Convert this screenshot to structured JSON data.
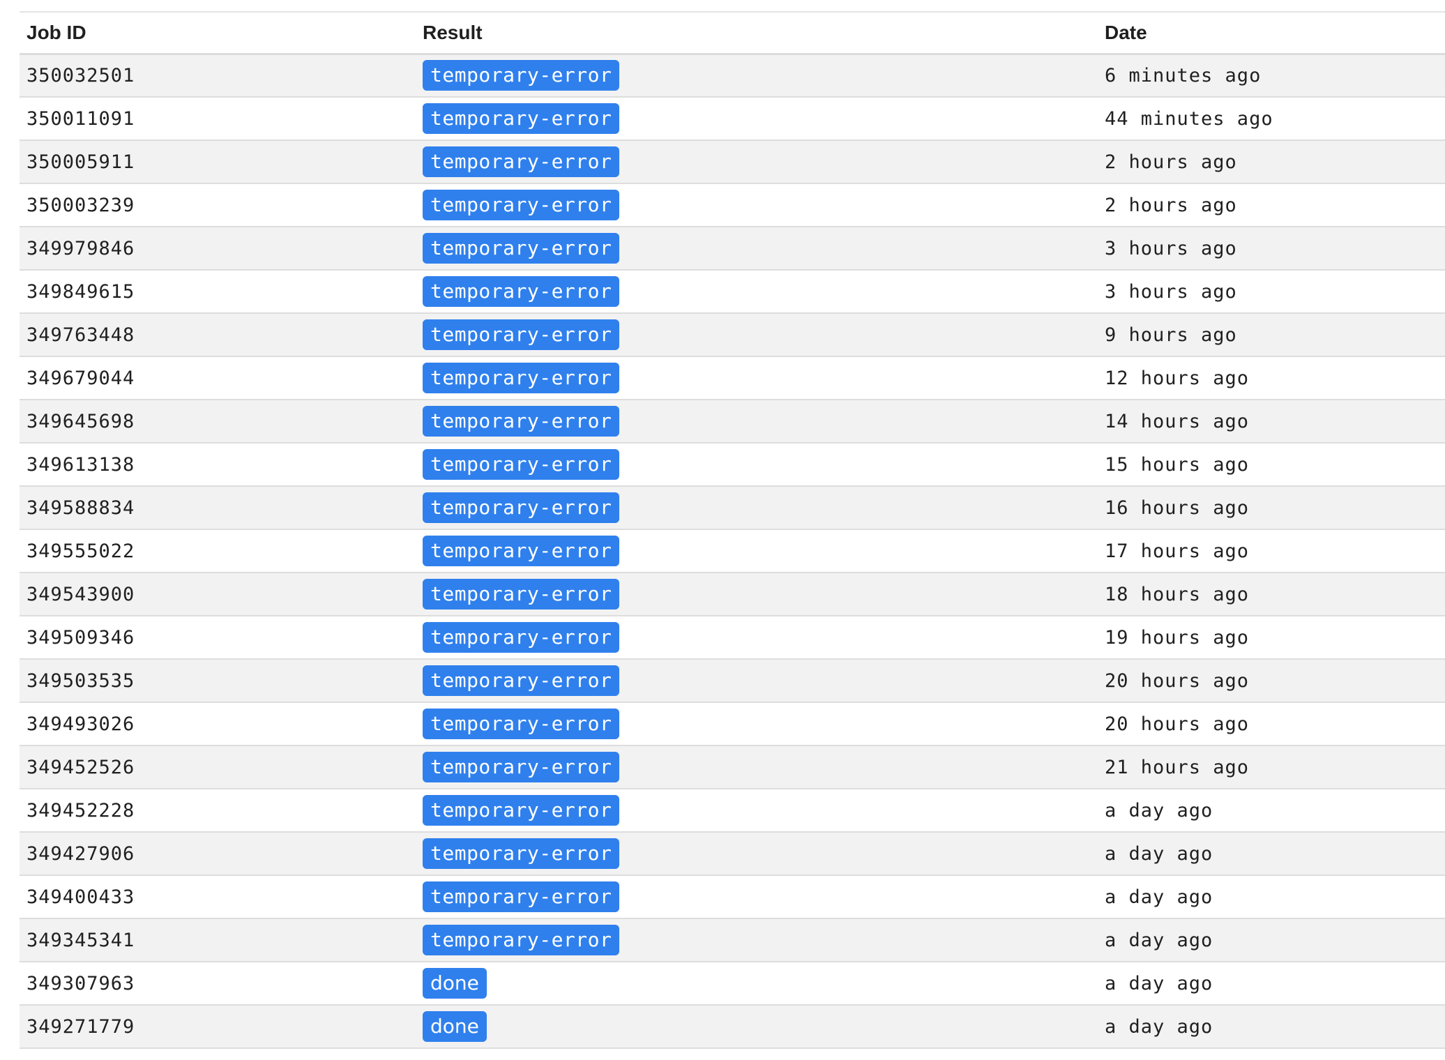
{
  "table": {
    "headers": {
      "job_id": "Job ID",
      "result": "Result",
      "date": "Date"
    },
    "rows": [
      {
        "job_id": "350032501",
        "result": "temporary-error",
        "date": "6 minutes ago"
      },
      {
        "job_id": "350011091",
        "result": "temporary-error",
        "date": "44 minutes ago"
      },
      {
        "job_id": "350005911",
        "result": "temporary-error",
        "date": "2 hours ago"
      },
      {
        "job_id": "350003239",
        "result": "temporary-error",
        "date": "2 hours ago"
      },
      {
        "job_id": "349979846",
        "result": "temporary-error",
        "date": "3 hours ago"
      },
      {
        "job_id": "349849615",
        "result": "temporary-error",
        "date": "3 hours ago"
      },
      {
        "job_id": "349763448",
        "result": "temporary-error",
        "date": "9 hours ago"
      },
      {
        "job_id": "349679044",
        "result": "temporary-error",
        "date": "12 hours ago"
      },
      {
        "job_id": "349645698",
        "result": "temporary-error",
        "date": "14 hours ago"
      },
      {
        "job_id": "349613138",
        "result": "temporary-error",
        "date": "15 hours ago"
      },
      {
        "job_id": "349588834",
        "result": "temporary-error",
        "date": "16 hours ago"
      },
      {
        "job_id": "349555022",
        "result": "temporary-error",
        "date": "17 hours ago"
      },
      {
        "job_id": "349543900",
        "result": "temporary-error",
        "date": "18 hours ago"
      },
      {
        "job_id": "349509346",
        "result": "temporary-error",
        "date": "19 hours ago"
      },
      {
        "job_id": "349503535",
        "result": "temporary-error",
        "date": "20 hours ago"
      },
      {
        "job_id": "349493026",
        "result": "temporary-error",
        "date": "20 hours ago"
      },
      {
        "job_id": "349452526",
        "result": "temporary-error",
        "date": "21 hours ago"
      },
      {
        "job_id": "349452228",
        "result": "temporary-error",
        "date": "a day ago"
      },
      {
        "job_id": "349427906",
        "result": "temporary-error",
        "date": "a day ago"
      },
      {
        "job_id": "349400433",
        "result": "temporary-error",
        "date": "a day ago"
      },
      {
        "job_id": "349345341",
        "result": "temporary-error",
        "date": "a day ago"
      },
      {
        "job_id": "349307963",
        "result": "done",
        "date": "a day ago"
      },
      {
        "job_id": "349271779",
        "result": "done",
        "date": "a day ago"
      }
    ]
  },
  "colors": {
    "badge": "#2f80ed",
    "row_stripe": "#f2f2f2"
  }
}
